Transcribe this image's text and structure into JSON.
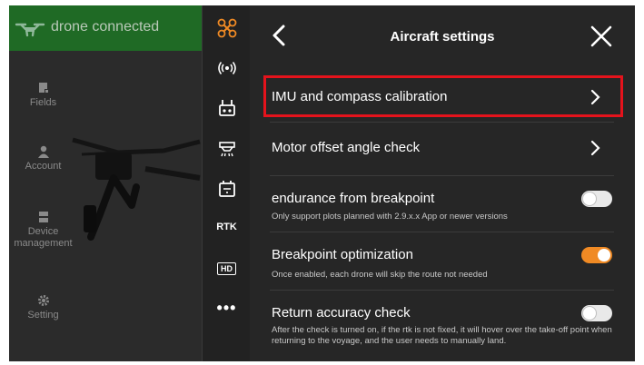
{
  "header": {
    "status_text": "drone connected"
  },
  "left_nav": {
    "items": [
      {
        "label": "Fields",
        "icon": "fields-icon"
      },
      {
        "label": "Account",
        "icon": "person-icon"
      },
      {
        "label": "Device management",
        "icon": "device-icon"
      },
      {
        "label": "Setting",
        "icon": "gear-icon"
      }
    ]
  },
  "rail": {
    "items": [
      {
        "icon": "drone-icon",
        "active": true
      },
      {
        "icon": "signal-icon"
      },
      {
        "icon": "remote-controller-icon"
      },
      {
        "icon": "spray-icon"
      },
      {
        "icon": "battery-icon"
      },
      {
        "label": "RTK"
      },
      {
        "label": "HD"
      },
      {
        "label": "•••"
      }
    ]
  },
  "panel": {
    "title": "Aircraft settings",
    "rows": [
      {
        "label": "IMU and compass calibration",
        "type": "link",
        "highlighted": true
      },
      {
        "label": "Motor offset angle check",
        "type": "link"
      },
      {
        "label": "endurance from breakpoint",
        "desc": "Only support plots planned with 2.9.x.x App or newer versions",
        "type": "toggle",
        "on": false
      },
      {
        "label": "Breakpoint optimization",
        "desc": "Once enabled, each drone will skip the route not needed",
        "type": "toggle",
        "on": true
      },
      {
        "label": "Return accuracy check",
        "desc": "After the check is turned on, if the rtk is not fixed, it will hover over the take-off point when returning to the voyage, and the user needs to manually land.",
        "type": "toggle",
        "on": false
      }
    ]
  },
  "colors": {
    "accent": "#f08a24",
    "highlight": "#e4131c",
    "connected": "#1f6a25",
    "rail_active": "#f08a24"
  }
}
